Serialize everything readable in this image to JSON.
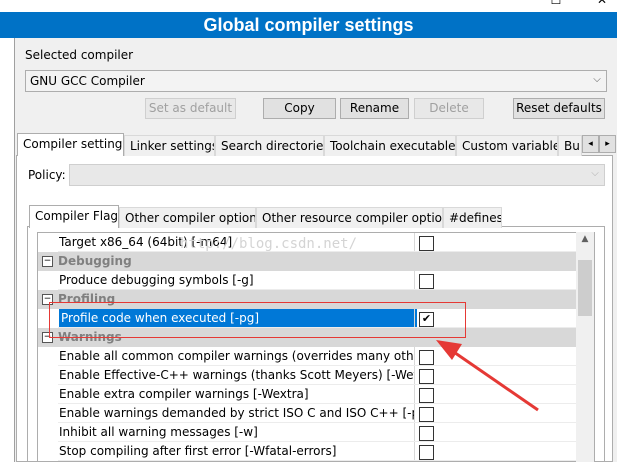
{
  "window": {
    "title": "Global compiler settings",
    "minimize_glyph": "–",
    "maximize_glyph": "☐",
    "close_glyph": "✕"
  },
  "selected_compiler": {
    "label": "Selected compiler",
    "value": "GNU GCC Compiler"
  },
  "compiler_buttons": {
    "set_default": "Set as default",
    "copy": "Copy",
    "rename": "Rename",
    "delete": "Delete",
    "reset_defaults": "Reset defaults"
  },
  "main_tabs": [
    "Compiler settings",
    "Linker settings",
    "Search directories",
    "Toolchain executables",
    "Custom variables",
    "Bui"
  ],
  "tab_scroll": {
    "left": "◂",
    "right": "▸"
  },
  "policy": {
    "label": "Policy:",
    "value": ""
  },
  "sub_tabs": [
    "Compiler Flags",
    "Other compiler options",
    "Other resource compiler options",
    "#defines"
  ],
  "watermark": "http://blog.csdn.net/",
  "flags": [
    {
      "kind": "flag",
      "label": "Target x86_64 (64bit)  [-m64]",
      "checked": false
    },
    {
      "kind": "category",
      "label": "Debugging",
      "toggle": "−"
    },
    {
      "kind": "flag",
      "label": "Produce debugging symbols  [-g]",
      "checked": false
    },
    {
      "kind": "category",
      "label": "Profiling",
      "toggle": "−"
    },
    {
      "kind": "flag",
      "label": "Profile code when executed  [-pg]",
      "checked": true,
      "selected": true
    },
    {
      "kind": "category",
      "label": "Warnings",
      "toggle": "−"
    },
    {
      "kind": "flag",
      "label": "Enable all common compiler warnings (overrides many other settings) [-Wall]",
      "checked": false
    },
    {
      "kind": "flag",
      "label": "Enable Effective-C++ warnings (thanks Scott Meyers)  [-Weffc++]",
      "checked": false
    },
    {
      "kind": "flag",
      "label": "Enable extra compiler warnings  [-Wextra]",
      "checked": false
    },
    {
      "kind": "flag",
      "label": "Enable warnings demanded by strict ISO C and ISO C++  [-pedantic]",
      "checked": false
    },
    {
      "kind": "flag",
      "label": "Inhibit all warning messages  [-w]",
      "checked": false
    },
    {
      "kind": "flag",
      "label": "Stop compiling after first error  [-Wfatal-errors]",
      "checked": false
    }
  ],
  "check_glyph": "✔",
  "colors": {
    "title_bar": "#0072c6",
    "selection": "#0078d7",
    "annotation": "#e53935"
  }
}
